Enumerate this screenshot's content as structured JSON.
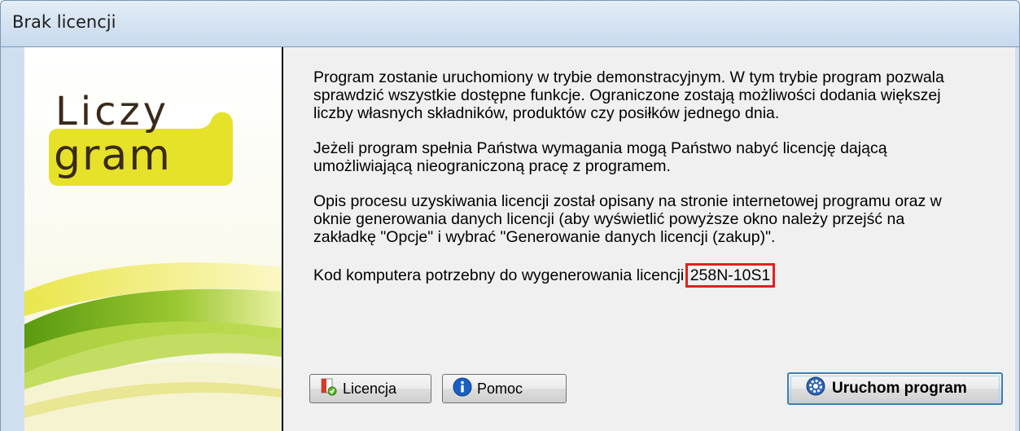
{
  "window": {
    "title": "Brak licencji"
  },
  "logo": {
    "line1": "Liczy",
    "line2": "gram",
    "colors": {
      "yellow": "#e6e22a",
      "green": "#7fb21f",
      "text": "#3a2a1a"
    }
  },
  "message": {
    "paragraph1_line1": "Program zostanie uruchomiony w trybie demonstracyjnym. W tym trybie program pozwala",
    "paragraph1_line2": "sprawdzić wszystkie dostępne funkcje. Ograniczone zostają możliwości dodania większej",
    "paragraph1_line3": "liczby własnych składników, produktów czy posiłków jednego dnia.",
    "paragraph2_line1": "Jeżeli program spełnia Państwa wymagania mogą Państwo nabyć licencję dającą",
    "paragraph2_line2": "umożliwiającą nieograniczoną pracę z programem.",
    "paragraph3_line1": "Opis procesu uzyskiwania licencji został opisany na stronie internetowej programu oraz w",
    "paragraph3_line2": "oknie generowania danych licencji (aby wyświetlić powyższe okno należy przejść na",
    "paragraph3_line3": "zakładkę \"Opcje\" i wybrać \"Generowanie danych licencji (zakup)\".",
    "code_label": "Kod komputera potrzebny do wygenerowania licencji:",
    "code_value": "258N-10S1"
  },
  "buttons": {
    "license_label": "Licencja",
    "license_icon": "license-icon",
    "help_label": "Pomoc",
    "help_icon": "info-icon",
    "run_label": "Uruchom program",
    "run_icon": "gear-icon"
  }
}
